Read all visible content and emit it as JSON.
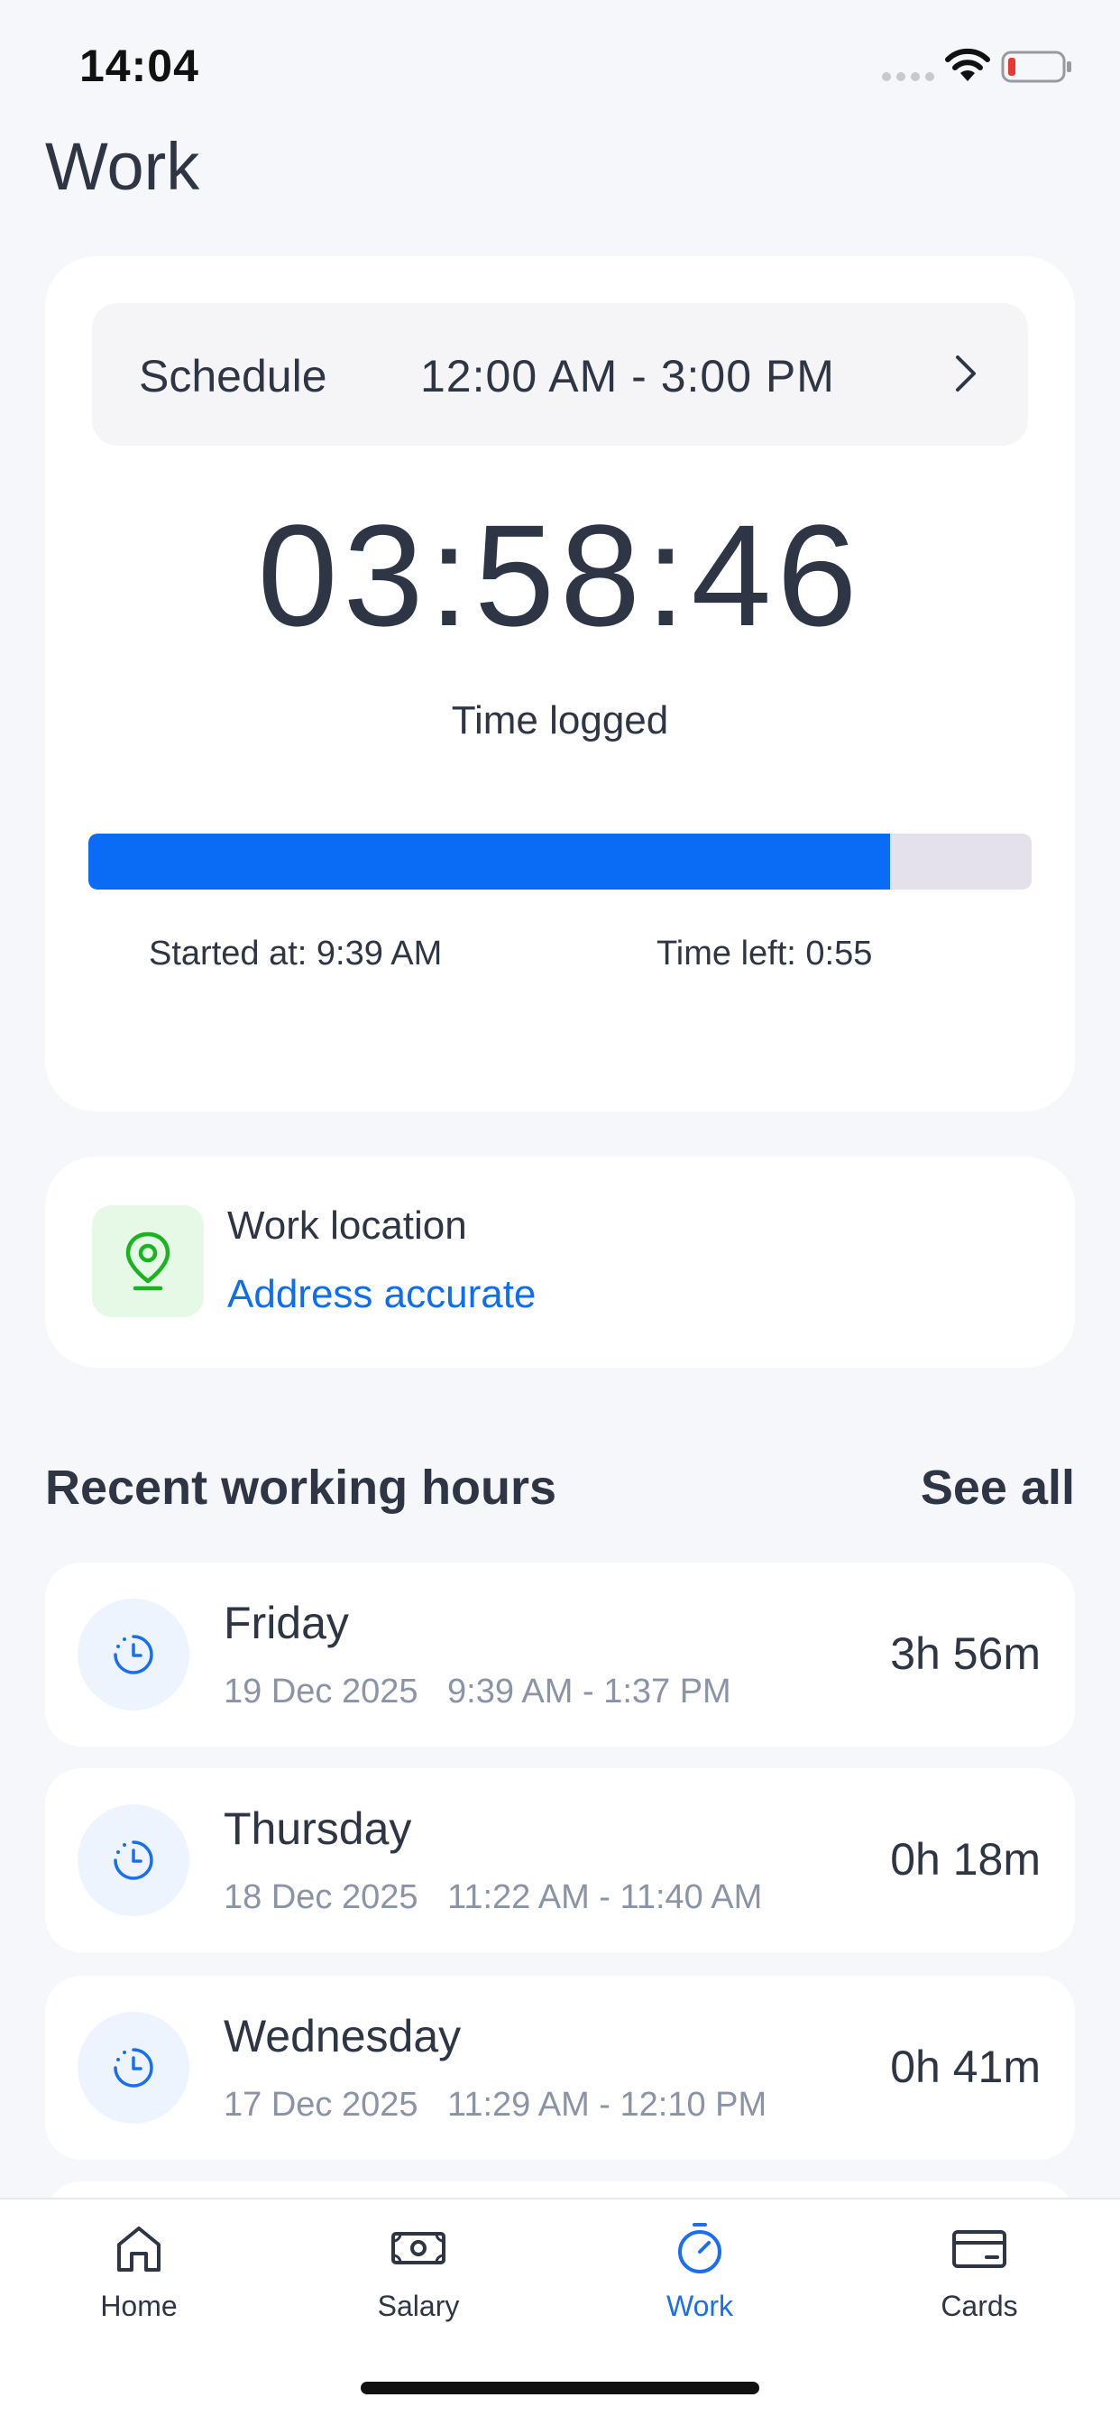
{
  "status_bar": {
    "time": "14:04"
  },
  "page": {
    "title": "Work"
  },
  "timer_card": {
    "schedule_label": "Schedule",
    "schedule_value": "12:00 AM - 3:00 PM",
    "timer": "03:58:46",
    "timer_caption": "Time logged",
    "progress_fraction": 0.85,
    "started_at": "Started at: 9:39 AM",
    "time_left": "Time left: 0:55"
  },
  "location_card": {
    "title": "Work location",
    "status": "Address accurate"
  },
  "recent": {
    "title": "Recent working hours",
    "see_all": "See all",
    "items": [
      {
        "day": "Friday",
        "date": "19 Dec 2025",
        "range": "9:39 AM - 1:37 PM",
        "duration": "3h 56m"
      },
      {
        "day": "Thursday",
        "date": "18 Dec 2025",
        "range": "11:22 AM - 11:40 AM",
        "duration": "0h 18m"
      },
      {
        "day": "Wednesday",
        "date": "17 Dec 2025",
        "range": "11:29 AM - 12:10 PM",
        "duration": "0h 41m"
      }
    ]
  },
  "tab_bar": {
    "tabs": [
      {
        "label": "Home",
        "icon": "home-icon"
      },
      {
        "label": "Salary",
        "icon": "banknote-icon"
      },
      {
        "label": "Work",
        "icon": "stopwatch-icon",
        "active": true
      },
      {
        "label": "Cards",
        "icon": "card-icon"
      }
    ]
  },
  "colors": {
    "accent": "#0a6cf5",
    "link": "#0d6ef0",
    "location_icon": "#1bb320",
    "background": "#f6f7fa"
  }
}
